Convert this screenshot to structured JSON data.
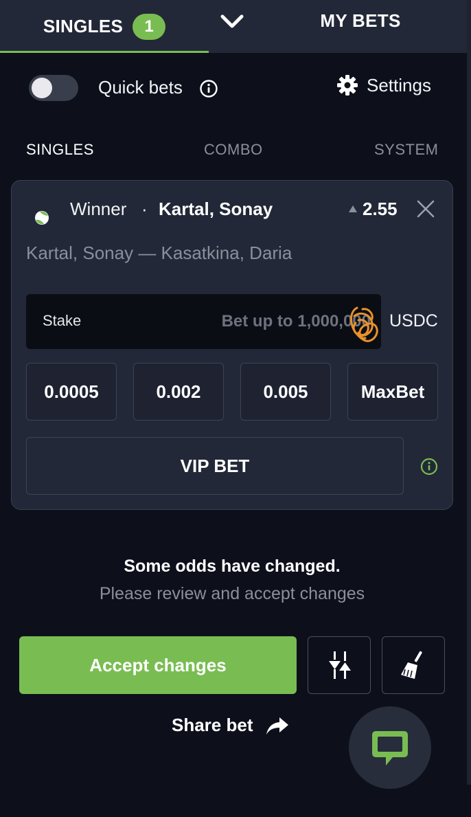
{
  "header": {
    "singles_tab": "SINGLES",
    "singles_count": "1",
    "mybets_tab": "MY BETS"
  },
  "quick_bets": {
    "label": "Quick bets",
    "enabled": false,
    "settings_label": "Settings"
  },
  "bet_types": [
    "SINGLES",
    "COMBO",
    "SYSTEM"
  ],
  "active_bet_type": "SINGLES",
  "bet": {
    "market": "Winner",
    "separator": "·",
    "selection": "Kartal, Sonay",
    "odds": "2.55",
    "odds_trend": "up",
    "event": "Kartal, Sonay — Kasatkina, Daria",
    "stake_label": "Stake",
    "stake_placeholder": "Bet up to 1,000,000",
    "stake_value": "",
    "currency": "USDC",
    "quick_amounts": [
      "0.0005",
      "0.002",
      "0.005",
      "MaxBet"
    ],
    "vip_label": "VIP BET"
  },
  "notice": {
    "title": "Some odds have changed.",
    "subtitle": "Please review and accept changes"
  },
  "actions": {
    "accept_label": "Accept changes",
    "share_label": "Share bet"
  },
  "colors": {
    "accent": "#79bd52",
    "background": "#0d101b",
    "card": "#232838",
    "muted_text": "#8a8f9c"
  },
  "icons": {
    "dropdown": "chevron-down-icon",
    "info": "info-icon",
    "settings": "gear-icon",
    "sport": "tennis-ball-icon",
    "odds_change": "triangle-up-icon",
    "remove": "close-icon",
    "filter": "sliders-icon",
    "clear": "broom-icon",
    "share": "share-arrow-icon",
    "chat": "chat-icon"
  }
}
